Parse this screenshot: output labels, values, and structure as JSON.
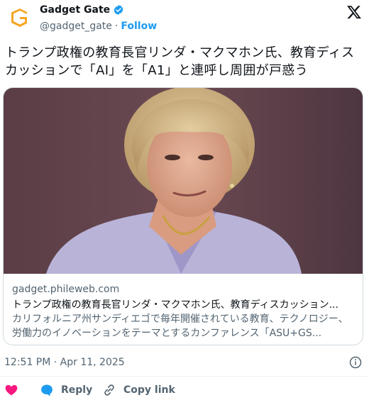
{
  "account": {
    "name": "Gadget Gate",
    "handle": "@gadget_gate",
    "separator": "·",
    "follow_label": "Follow"
  },
  "tweet": {
    "text": "トランプ政権の教育長官リンダ・マクマホン氏、教育ディスカッションで「AI」を「A1」と連呼し周囲が戸惑う",
    "timestamp": "12:51 PM · Apr 11, 2025"
  },
  "card": {
    "domain": "gadget.phileweb.com",
    "title": "トランプ政権の教育長官リンダ・マクマホン氏、教育ディスカッション...",
    "description": "カリフォルニア州サンディエゴで毎年開催されている教育、テクノロジー、労働力のイノベーションをテーマとするカンファレンス「ASU+GS..."
  },
  "actions": {
    "reply_label": "Reply",
    "copy_link_label": "Copy link"
  },
  "colors": {
    "accent": "#1d9bf0",
    "like": "#f91880",
    "logo_orange": "#f5a623"
  }
}
